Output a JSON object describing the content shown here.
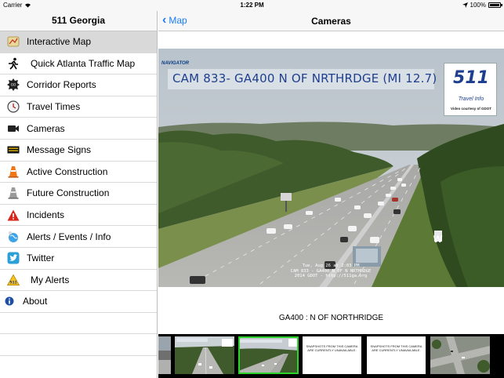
{
  "status_bar": {
    "carrier": "Carrier",
    "time": "1:22 PM",
    "battery": "100%",
    "battery_level": 1.0
  },
  "sidebar": {
    "title": "511 Georgia",
    "items": [
      {
        "label": "Interactive Map",
        "icon": "map-icon",
        "selected": true
      },
      {
        "label": "Quick Atlanta Traffic Map",
        "icon": "runner-icon"
      },
      {
        "label": "Corridor Reports",
        "icon": "report-badge-icon"
      },
      {
        "label": "Travel Times",
        "icon": "clock-icon"
      },
      {
        "label": "Cameras",
        "icon": "video-camera-icon"
      },
      {
        "label": "Message Signs",
        "icon": "message-sign-icon"
      },
      {
        "label": "Active Construction",
        "icon": "orange-cone-icon"
      },
      {
        "label": "Future Construction",
        "icon": "gray-cone-icon"
      },
      {
        "label": "Incidents",
        "icon": "warning-icon"
      },
      {
        "label": "Alerts / Events / Info",
        "icon": "globe-icon"
      },
      {
        "label": "Twitter",
        "icon": "twitter-icon"
      },
      {
        "label": "My Alerts",
        "icon": "511-badge-icon"
      },
      {
        "label": "About",
        "icon": "info-icon"
      }
    ]
  },
  "detail": {
    "back_label": "Map",
    "title": "Cameras",
    "camera": {
      "overlay_title": "CAM 833- GA400 N OF NRTHRDGE (MI 12.7)",
      "brand": "NAVIGATOR",
      "logo_number": "511",
      "logo_sub": "Travel Info",
      "logo_credit": "Video courtesy of GDOT",
      "timestamp_line1": "Tue, Aug 26 at 2:03 PM",
      "timestamp_line2": "CAM 833 - GA400 N OF N NRTHRDGE",
      "timestamp_line3": "2014 GDOT - http://511ga.org",
      "sign_letter": "W"
    },
    "caption": "GA400 : N OF NORTHRIDGE",
    "thumbnails": [
      {
        "type": "image"
      },
      {
        "type": "image"
      },
      {
        "type": "image",
        "selected": true
      },
      {
        "type": "text",
        "text": "SNAPSHOTS FROM THIS CAMERA ARE CURRENTLY UNAVAILABLE."
      },
      {
        "type": "text",
        "text": "SNAPSHOTS FROM THIS CAMERA ARE CURRENTLY UNAVAILABLE."
      },
      {
        "type": "image"
      }
    ]
  },
  "colors": {
    "accent": "#1a7cf5",
    "selected_row": "#d9d9d9",
    "selected_thumb": "#2bd32b",
    "bar_bg": "#f7f7f7"
  }
}
